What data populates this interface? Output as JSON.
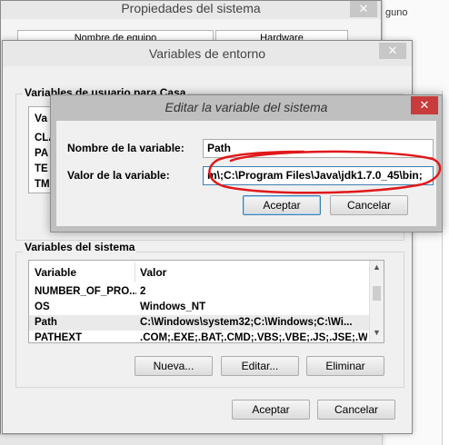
{
  "background_window": {
    "partial_text": "guno"
  },
  "system_props": {
    "title": "Propiedades del sistema",
    "tabs": [
      "Nombre de equipo",
      "Hardware"
    ]
  },
  "env_vars": {
    "title": "Variables de entorno",
    "user_group_label": "Variables de usuario para Casa",
    "user_rows_partial": [
      "Va",
      "CLA",
      "PA",
      "TE",
      "TM"
    ],
    "system_group_label": "Variables del sistema",
    "columns": [
      "Variable",
      "Valor"
    ],
    "system_rows": [
      {
        "name": "NUMBER_OF_PRO...",
        "value": "2"
      },
      {
        "name": "OS",
        "value": "Windows_NT"
      },
      {
        "name": "Path",
        "value": "C:\\Windows\\system32;C:\\Windows;C:\\Wi..."
      },
      {
        "name": "PATHEXT",
        "value": ".COM;.EXE;.BAT;.CMD;.VBS;.VBE;.JS;.JSE;.WS..."
      }
    ],
    "buttons": {
      "new": "Nueva...",
      "edit": "Editar...",
      "delete": "Eliminar",
      "ok": "Aceptar",
      "cancel": "Cancelar"
    }
  },
  "edit_dialog": {
    "title": "Editar la variable del sistema",
    "name_label": "Nombre de la variable:",
    "name_value": "Path",
    "value_label": "Valor de la variable:",
    "value_value": "m\\;C:\\Program Files\\Java\\jdk1.7.0_45\\bin;",
    "ok": "Aceptar",
    "cancel": "Cancelar",
    "annotation_color": "#e0181a"
  }
}
